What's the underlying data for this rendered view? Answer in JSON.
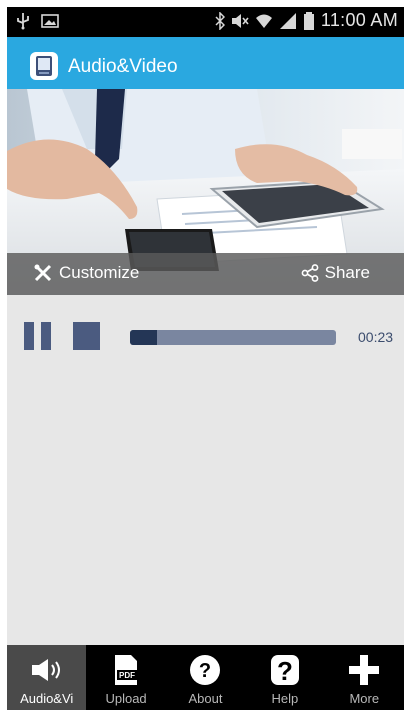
{
  "status_bar": {
    "time": "11:00 AM",
    "icons": [
      "usb-icon",
      "image-icon",
      "bluetooth-icon",
      "mute-icon",
      "wifi-icon",
      "signal-icon",
      "battery-icon"
    ]
  },
  "app_bar": {
    "title": "Audio&Video",
    "icon": "audio-document-icon",
    "color": "#2aa8e0"
  },
  "hero": {
    "customize_label": "Customize",
    "share_label": "Share"
  },
  "player": {
    "time": "00:23",
    "progress": 0.13,
    "controls": [
      "pause-icon",
      "stop-icon"
    ]
  },
  "bottom_nav": [
    {
      "label": "Audio&Vi",
      "icon": "speaker-icon",
      "active": true
    },
    {
      "label": "Upload",
      "icon": "pdf-icon",
      "active": false
    },
    {
      "label": "About",
      "icon": "question-circle-icon",
      "active": false
    },
    {
      "label": "Help",
      "icon": "question-box-icon",
      "active": false
    },
    {
      "label": "More",
      "icon": "plus-icon",
      "active": false
    }
  ],
  "pdf_badge": "PDF"
}
